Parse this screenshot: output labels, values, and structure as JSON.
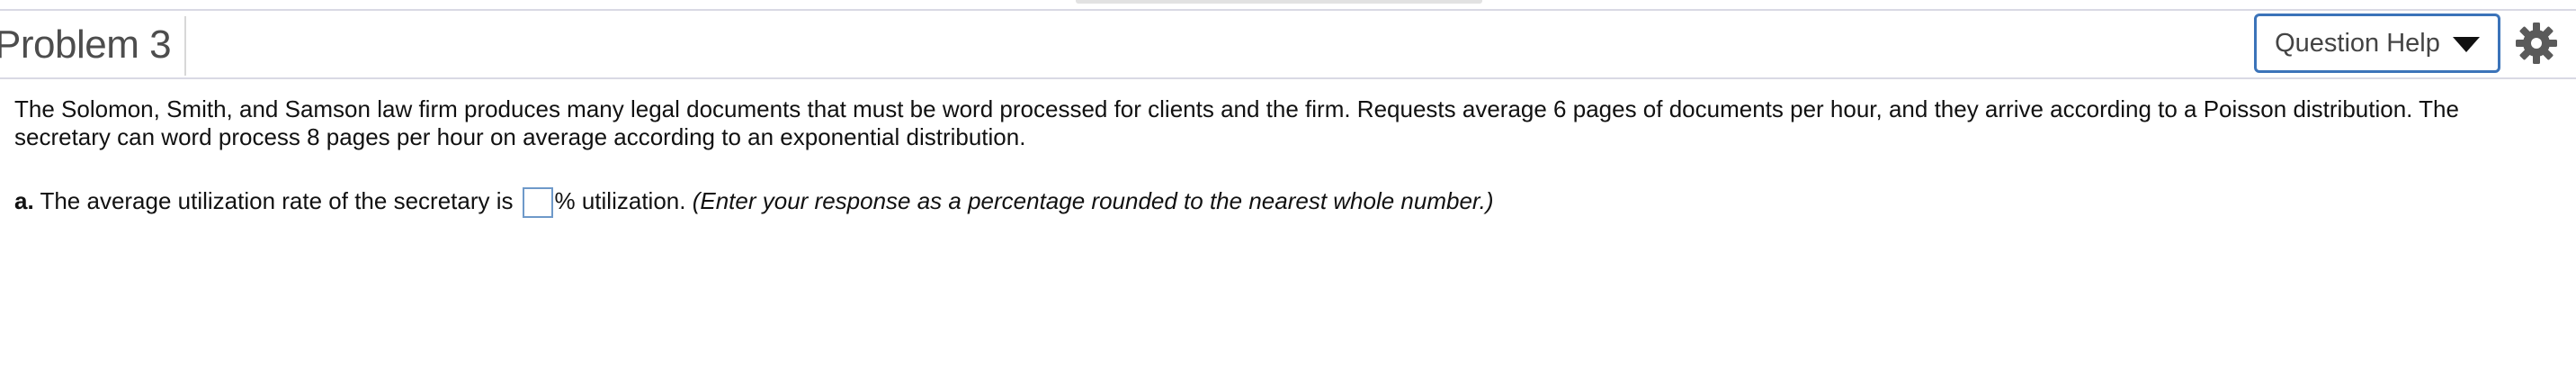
{
  "header": {
    "title": "Problem 3",
    "help_button_label": "Question Help"
  },
  "icons": {
    "help_caret": "triangle-down-icon",
    "settings": "gear-icon"
  },
  "colors": {
    "help_button_border": "#3b73b9",
    "answer_box_border": "#6e99c9",
    "title_text": "#4d4d4d",
    "gear": "#5a5a5a"
  },
  "problem": {
    "statement": "The Solomon, Smith, and Samson law firm produces many legal documents that must be word processed for clients and the firm. Requests average 6 pages of documents per hour, and they arrive according to a Poisson distribution. The secretary can word process 8 pages per hour on average according to an exponential distribution."
  },
  "part_a": {
    "letter": "a.",
    "prompt": "The average utilization rate of the secretary is",
    "answer_value": "",
    "suffix": "% utilization.",
    "instruction": "(Enter your response as a percentage rounded to the nearest whole number.)"
  }
}
